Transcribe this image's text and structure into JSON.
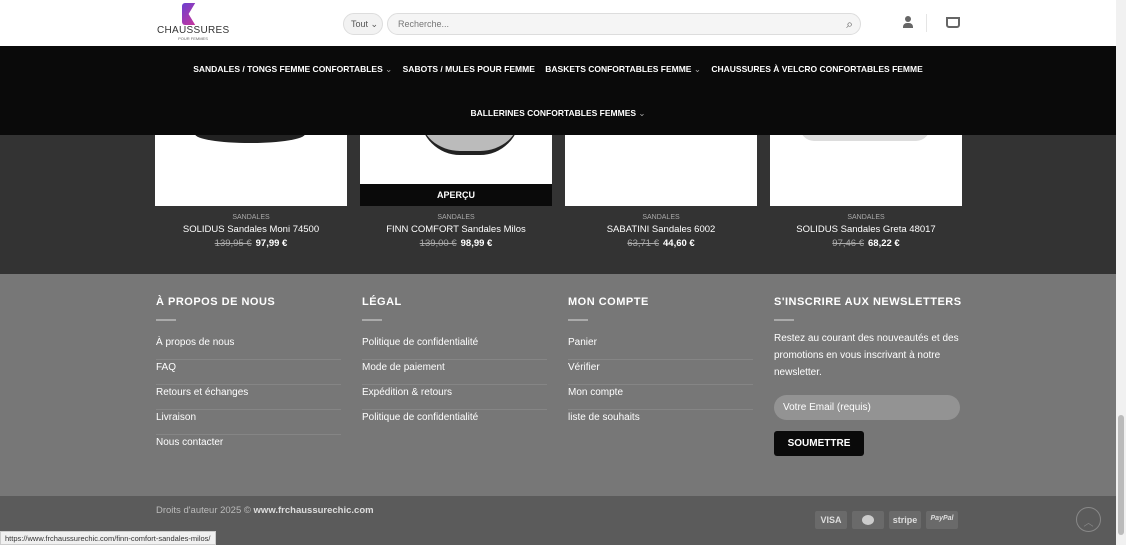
{
  "header": {
    "logo_text": "CHAUSSURES",
    "logo_sub": "POUR FEMMES",
    "category_select": "Tout",
    "search_placeholder": "Recherche..."
  },
  "nav": {
    "items": [
      {
        "label": "SANDALES / TONGS FEMME CONFORTABLES",
        "dropdown": true
      },
      {
        "label": "SABOTS / MULES POUR FEMME",
        "dropdown": false
      },
      {
        "label": "BASKETS CONFORTABLES FEMME",
        "dropdown": true
      },
      {
        "label": "CHAUSSURES À VELCRO CONFORTABLES FEMME",
        "dropdown": false
      },
      {
        "label": "BALLERINES CONFORTABLES FEMMES",
        "dropdown": true
      }
    ]
  },
  "products": [
    {
      "category": "SANDALES",
      "name": "SOLIDUS Sandales Moni 74500",
      "old_price": "139,95 €",
      "price": "97,99 €"
    },
    {
      "category": "SANDALES",
      "name": "FINN COMFORT Sandales Milos",
      "old_price": "139,00 €",
      "price": "98,99 €",
      "overlay": "APERÇU"
    },
    {
      "category": "SANDALES",
      "name": "SABATINI Sandales 6002",
      "old_price": "63,71 €",
      "price": "44,60 €"
    },
    {
      "category": "SANDALES",
      "name": "SOLIDUS Sandales Greta 48017",
      "old_price": "97,46 €",
      "price": "68,22 €"
    }
  ],
  "footer": {
    "about": {
      "title": "À PROPOS DE NOUS",
      "links": [
        "À propos de nous",
        "FAQ",
        "Retours et échanges",
        "Livraison",
        "Nous contacter"
      ]
    },
    "legal": {
      "title": "LÉGAL",
      "links": [
        "Politique de confidentialité",
        "Mode de paiement",
        "Expédition & retours",
        "Politique de confidentialité"
      ]
    },
    "account": {
      "title": "MON COMPTE",
      "links": [
        "Panier",
        "Vérifier",
        "Mon compte",
        "liste de souhaits"
      ]
    },
    "newsletter": {
      "title": "S'INSCRIRE AUX NEWSLETTERS",
      "text": "Restez au courant des nouveautés et des promotions en vous inscrivant à notre newsletter.",
      "email_placeholder": "Votre Email (requis)",
      "submit": "SOUMETTRE"
    }
  },
  "bottom": {
    "copyright": "Droits d'auteur 2025 © ",
    "site": "www.frchaussurechic.com",
    "payments": [
      "VISA",
      "MC",
      "stripe",
      "PayPal"
    ]
  },
  "status_url": "https://www.frchaussurechic.com/finn-comfort-sandales-milos/"
}
